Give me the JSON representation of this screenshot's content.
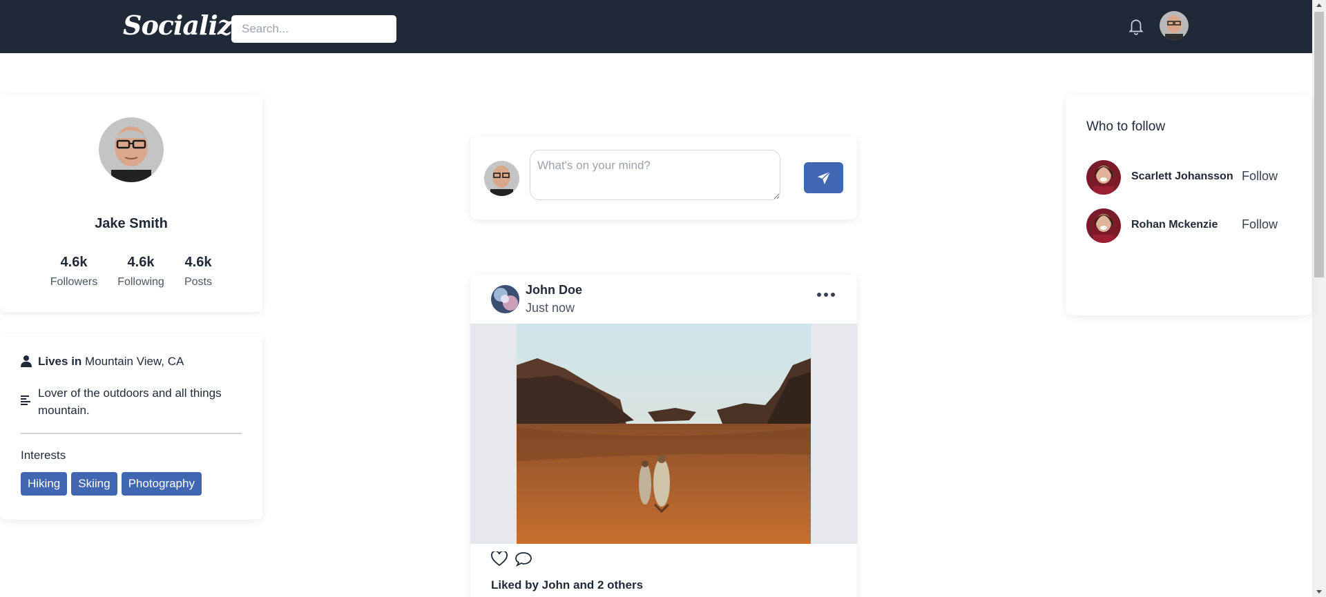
{
  "app": {
    "logo": "Socialize"
  },
  "navbar": {
    "search_placeholder": "Search...",
    "bell_icon": "bell-icon",
    "avatar_icon": "user-avatar"
  },
  "profile": {
    "name": "Jake Smith",
    "stats": [
      {
        "value": "4.6k",
        "label": "Followers"
      },
      {
        "value": "4.6k",
        "label": "Following"
      },
      {
        "value": "4.6k",
        "label": "Posts"
      }
    ]
  },
  "about": {
    "lives_in_label": "Lives in",
    "location": "Mountain View, CA",
    "bio_line1": "Lover of the outdoors and all things",
    "bio_line2": "mountain.",
    "interests_title": "Interests",
    "interests": [
      "Hiking",
      "Skiing",
      "Photography"
    ]
  },
  "composer": {
    "placeholder": "What's on your mind?",
    "send_icon": "paper-plane-icon"
  },
  "post": {
    "author": "John Doe",
    "time": "Just now",
    "liked_by": "Liked by John and 2 others"
  },
  "who_to_follow": {
    "title": "Who to follow",
    "users": [
      {
        "name": "Scarlett Johansson",
        "action": "Follow"
      },
      {
        "name": "Rohan Mckenzie",
        "action": "Follow"
      }
    ]
  },
  "colors": {
    "navbar": "#1f2937",
    "accent": "#4267b2"
  }
}
